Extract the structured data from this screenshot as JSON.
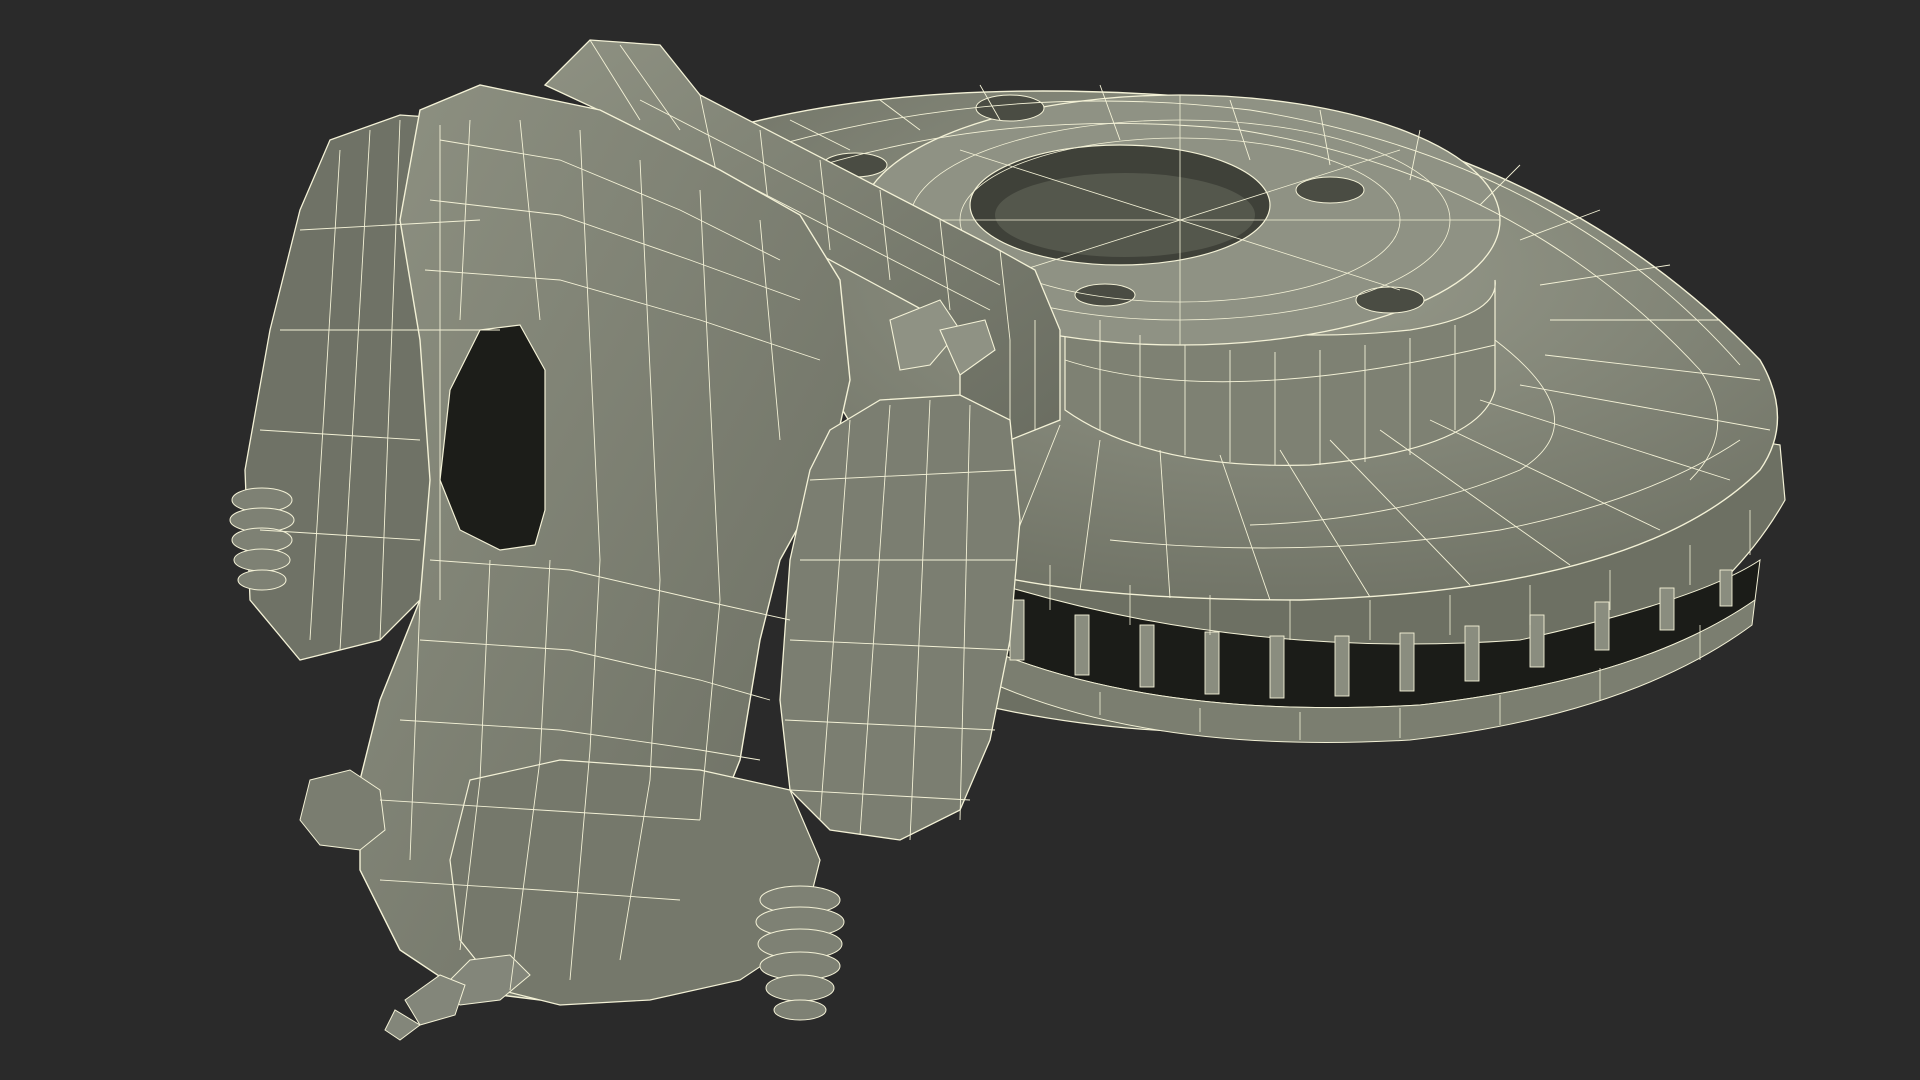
{
  "scene": {
    "subject": "brake-caliper-and-vented-disc-wireframe",
    "background_color": "#2a2a2a",
    "surface_color": "#86897a",
    "surface_shadow_color": "#5d6054",
    "wire_color": "#f3f1d6"
  }
}
